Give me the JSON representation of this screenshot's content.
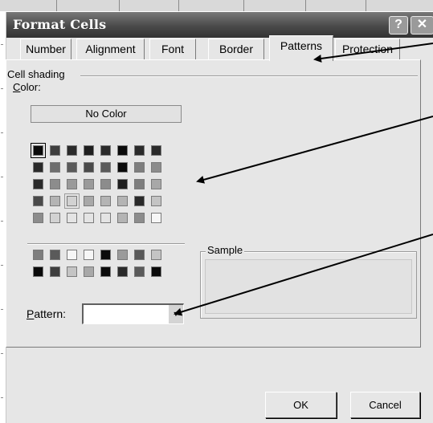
{
  "dialog": {
    "title": "Format Cells",
    "help_label": "?",
    "close_label": "✕"
  },
  "tabs": [
    {
      "label": "Number",
      "active": false
    },
    {
      "label": "Alignment",
      "active": false
    },
    {
      "label": "Font",
      "active": false
    },
    {
      "label": "Border",
      "active": false
    },
    {
      "label": "Patterns",
      "active": true
    },
    {
      "label": "Protection",
      "active": false
    }
  ],
  "cell_shading": {
    "group_label": "Cell shading",
    "color_label_mnemonic": "C",
    "color_label_rest": "olor:",
    "no_color_label": "No Color"
  },
  "palette": {
    "colors": {
      "a": "#0a0a0a",
      "b": "#3e3e3e",
      "c": "#2a2a2a",
      "d": "#1e1e1e",
      "e": "#4a4a4a",
      "f": "#5a5a5a",
      "g": "#6e6e6e",
      "h": "#7e7e7e",
      "i": "#8c8c8c",
      "j": "#9a9a9a",
      "k": "#a8a8a8",
      "l": "#b4b4b4",
      "m": "#c4c4c4",
      "n": "#d2d2d2",
      "o": "#e4e4e4",
      "p": "#f6f6f6"
    },
    "rows": [
      [
        "a",
        "b",
        "c",
        "d",
        "c",
        "a",
        "c",
        "c"
      ],
      [
        "c",
        "g",
        "f",
        "e",
        "f",
        "a",
        "h",
        "i"
      ],
      [
        "c",
        "i",
        "j",
        "j",
        "i",
        "d",
        "h",
        "k"
      ],
      [
        "e",
        "l",
        "n",
        "k",
        "l",
        "l",
        "c",
        "m"
      ],
      [
        "i",
        "n",
        "o",
        "o",
        "o",
        "l",
        "i",
        "p"
      ],
      [
        "h",
        "f",
        "p",
        "p",
        "a",
        "j",
        "f",
        "m"
      ],
      [
        "a",
        "b",
        "m",
        "k",
        "a",
        "c",
        "f",
        "a"
      ]
    ],
    "selected": "0,0",
    "hover": "3,2"
  },
  "sample": {
    "label": "Sample"
  },
  "pattern": {
    "label_mnemonic": "P",
    "label_rest": "attern:",
    "value": "",
    "dropdown_icon": "▼"
  },
  "buttons": {
    "ok_label": "OK",
    "cancel_label": "Cancel"
  }
}
